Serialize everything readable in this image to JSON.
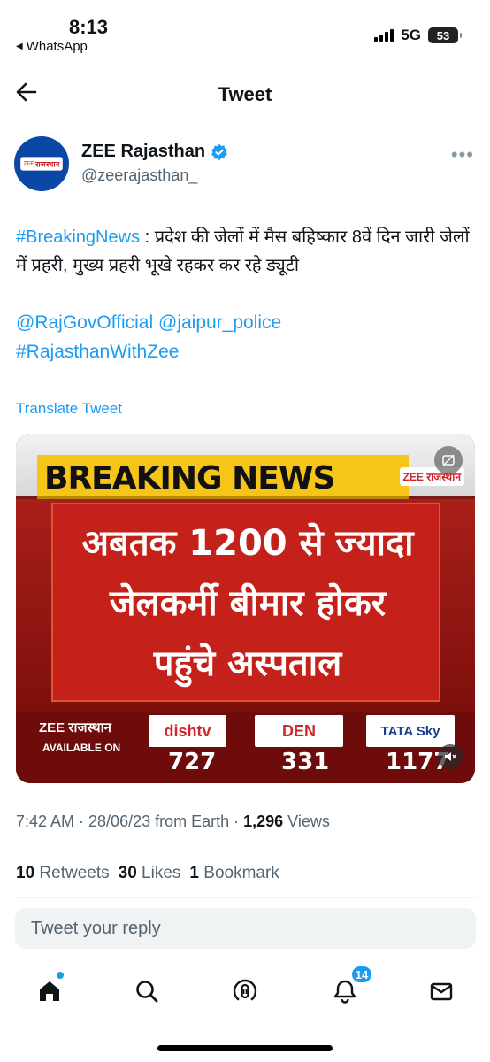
{
  "status_bar": {
    "time": "8:13",
    "back_app": "WhatsApp",
    "network": "5G",
    "battery": "53"
  },
  "header": {
    "title": "Tweet"
  },
  "author": {
    "name": "ZEE Rajasthan",
    "handle": "@zeerajasthan_",
    "avatar_text_small": "ZEE",
    "avatar_text": "राजस्थान"
  },
  "tweet": {
    "hashtag": "#BreakingNews",
    "text": " : प्रदेश की जेलों में मैस बहिष्कार 8वें दिन जारी जेलों में प्रहरी, मुख्य प्रहरी भूखे रहकर कर रहे ड्यूटी",
    "mention1": "@RajGovOfficial",
    "mention2": "@jaipur_police",
    "hashtag2": "#RajasthanWithZee",
    "translate": "Translate Tweet"
  },
  "media": {
    "banner": "BREAKING NEWS",
    "logo": "ZEE राजस्थान",
    "headline_lines": [
      "अबतक 1200 से ज्यादा",
      "जेलकर्मी बीमार होकर",
      "पहुंचे अस्पताल"
    ],
    "footer_brand": "ZEE राजस्थान",
    "available_on": "AVAILABLE ON",
    "channels": [
      {
        "name": "dishtv",
        "number": "727"
      },
      {
        "name": "DEN",
        "number": "331"
      },
      {
        "name": "TATA Sky",
        "number": "1177"
      }
    ]
  },
  "meta": {
    "time_date_source": "7:42 AM · 28/06/23 from Earth · ",
    "views_count": "1,296",
    "views_label": " Views"
  },
  "stats": {
    "retweets_count": "10",
    "retweets_label": "Retweets",
    "likes_count": "30",
    "likes_label": "Likes",
    "bookmarks_count": "1",
    "bookmarks_label": "Bookmark"
  },
  "reply": {
    "placeholder": "Tweet your reply"
  },
  "tabbar": {
    "notifications_badge": "14"
  },
  "colors": {
    "accent": "#1d9bf0",
    "text": "#0f1419",
    "muted": "#536471"
  }
}
